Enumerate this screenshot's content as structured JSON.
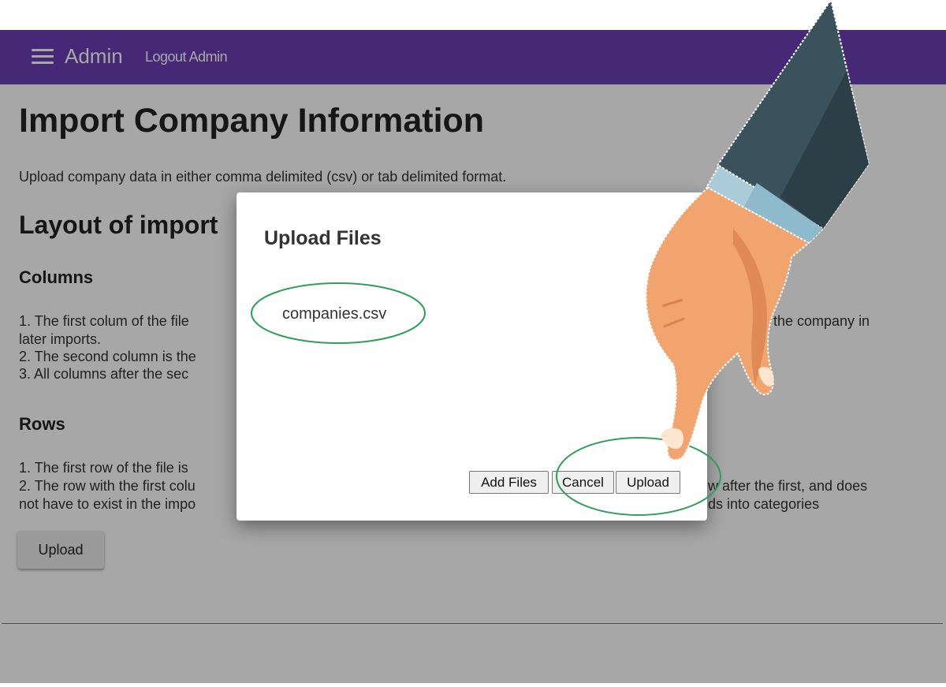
{
  "header": {
    "app_title": "Admin",
    "logout_link": "Logout Admin"
  },
  "page": {
    "title": "Import Company Information",
    "intro": "Upload company data in either comma delimited (csv) or tab delimited format.",
    "layout_heading": "Layout of import",
    "columns_heading": "Columns",
    "columns_lines": [
      "1. The first colum of the file",
      "later imports.",
      "2. The second column is the",
      "3. All columns after the sec"
    ],
    "columns_line1_tail": "ify the company in",
    "rows_heading": "Rows",
    "rows_lines": [
      "1. The first row of the file is",
      "2. The row with the first colu",
      "not have to exist in the impo"
    ],
    "rows_line2_tail": "w after the first, and does",
    "rows_line3_tail": "ds into categories",
    "upload_button": "Upload"
  },
  "dialog": {
    "title": "Upload Files",
    "file_name": "companies.csv",
    "add_files_button": "Add Files",
    "cancel_button": "Cancel",
    "upload_button": "Upload"
  },
  "colors": {
    "header_bg": "#6a3fb6",
    "annotation_green": "#2f9e5b",
    "overlay": "rgba(0,0,0,0.345)"
  },
  "icons": {
    "menu": "hamburger-menu-icon",
    "pointer": "pointing-hand-illustration"
  }
}
